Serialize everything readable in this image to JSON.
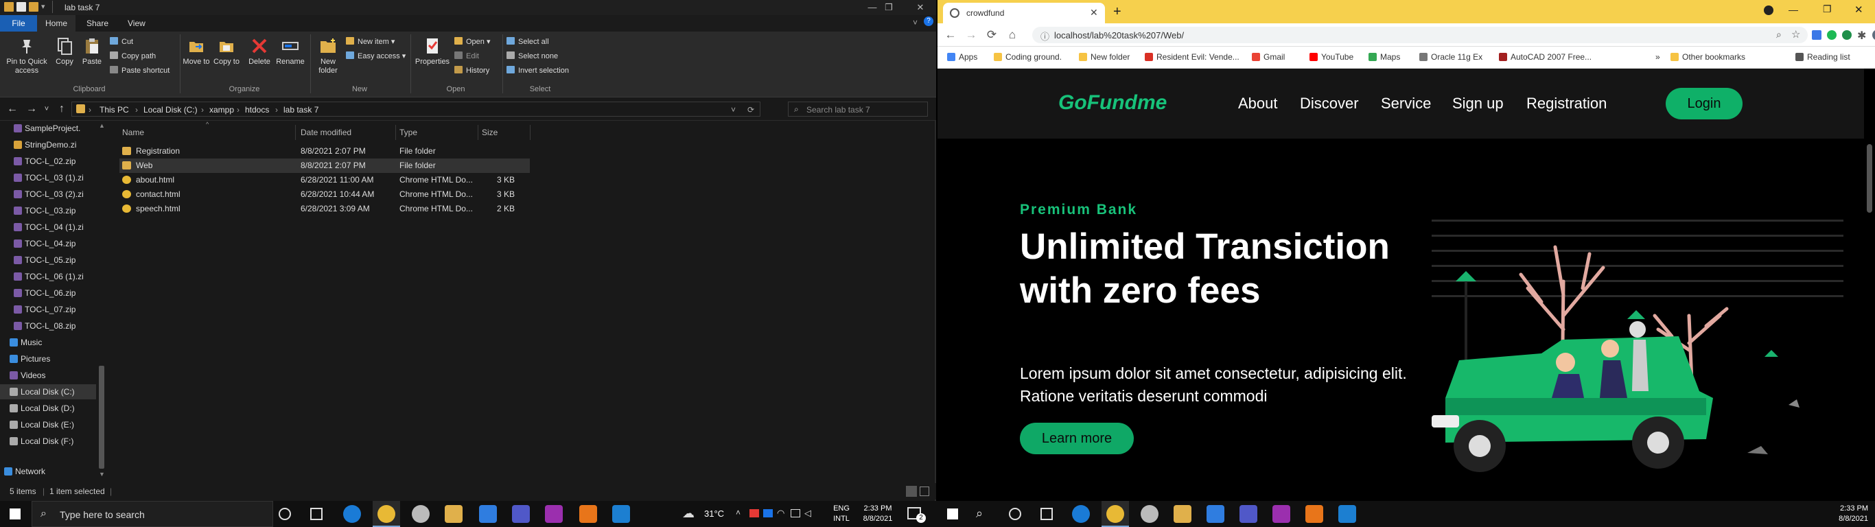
{
  "explorer": {
    "title": "lab task 7",
    "ribbon_tabs": [
      "File",
      "Home",
      "Share",
      "View"
    ],
    "clipboard": {
      "pin": "Pin to Quick access",
      "copy": "Copy",
      "paste": "Paste",
      "cut": "Cut",
      "copy_path": "Copy path",
      "paste_shortcut": "Paste shortcut",
      "group": "Clipboard"
    },
    "organize": {
      "move_to": "Move to",
      "copy_to": "Copy to",
      "delete": "Delete",
      "rename": "Rename",
      "group": "Organize"
    },
    "new": {
      "new_folder": "New folder",
      "new_item": "New item",
      "easy_access": "Easy access",
      "group": "New"
    },
    "open": {
      "properties": "Properties",
      "open": "Open",
      "edit": "Edit",
      "history": "History",
      "group": "Open"
    },
    "select": {
      "select_all": "Select all",
      "select_none": "Select none",
      "invert": "Invert selection",
      "group": "Select"
    },
    "path": [
      "This PC",
      "Local Disk (C:)",
      "xampp",
      "htdocs",
      "lab task 7"
    ],
    "search_placeholder": "Search lab task 7",
    "nav_items": [
      "SampleProject.",
      "StringDemo.zi",
      "TOC-L_02.zip",
      "TOC-L_03 (1).zi",
      "TOC-L_03 (2).zi",
      "TOC-L_03.zip",
      "TOC-L_04 (1).zi",
      "TOC-L_04.zip",
      "TOC-L_05.zip",
      "TOC-L_06 (1).zi",
      "TOC-L_06.zip",
      "TOC-L_07.zip",
      "TOC-L_08.zip",
      "Music",
      "Pictures",
      "Videos",
      "Local Disk (C:)",
      "Local Disk (D:)",
      "Local Disk (E:)",
      "Local Disk (F:)",
      "Network"
    ],
    "columns": [
      "Name",
      "Date modified",
      "Type",
      "Size"
    ],
    "files": [
      {
        "name": "Registration",
        "date": "8/8/2021 2:07 PM",
        "type": "File folder",
        "size": ""
      },
      {
        "name": "Web",
        "date": "8/8/2021 2:07 PM",
        "type": "File folder",
        "size": ""
      },
      {
        "name": "about.html",
        "date": "6/28/2021 11:00 AM",
        "type": "Chrome HTML Do...",
        "size": "3 KB"
      },
      {
        "name": "contact.html",
        "date": "6/28/2021 10:44 AM",
        "type": "Chrome HTML Do...",
        "size": "3 KB"
      },
      {
        "name": "speech.html",
        "date": "6/28/2021 3:09 AM",
        "type": "Chrome HTML Do...",
        "size": "2 KB"
      }
    ],
    "status": {
      "count": "5 items",
      "selected": "1 item selected"
    }
  },
  "browser": {
    "tab_title": "crowdfund",
    "url": "localhost/lab%20task%207/Web/",
    "bookmarks": [
      "Apps",
      "Coding ground.",
      "New folder",
      "Resident Evil: Vende...",
      "Gmail",
      "YouTube",
      "Maps",
      "Oracle 11g Ex",
      "AutoCAD 2007 Free...",
      "Other bookmarks",
      "Reading list"
    ]
  },
  "site": {
    "brand": "GoFundme",
    "nav": [
      "About",
      "Discover",
      "Service",
      "Sign up",
      "Registration"
    ],
    "login": "Login",
    "kicker": "Premium Bank",
    "title": "Unlimited Transiction with zero fees",
    "subtitle": "Lorem ipsum dolor sit amet consectetur, adipisicing elit. Ratione veritatis deserunt commodi",
    "cta": "Learn more"
  },
  "taskbar": {
    "search_placeholder": "Type here to search",
    "weather": "31°C",
    "lang1": "ENG",
    "lang2": "INTL",
    "time": "2:33 PM",
    "date": "8/8/2021",
    "notif": "2"
  },
  "colors": {
    "brand_green": "#17c27a",
    "chrome_yellow": "#f6d04d",
    "file_tab": "#1a5fb4"
  }
}
